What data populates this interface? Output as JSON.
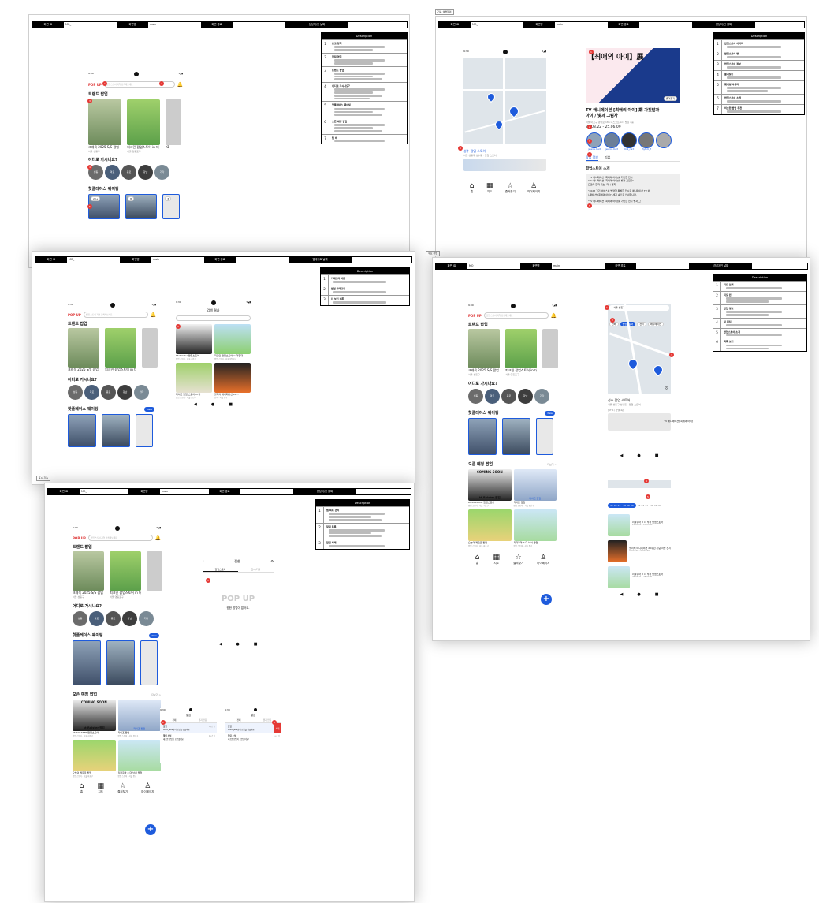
{
  "header": {
    "screen_id_label": "화면 ID",
    "screen_id_value": "MO_",
    "screen_name_label": "화면명",
    "screen_name_value": "main",
    "path_label": "화면 경로",
    "owner": "담당자/인 날짜",
    "owner_alt": "업데이트 날짜"
  },
  "description_title": "Description",
  "panel_tags": [
    "기능 설명정의",
    "주요 화면",
    "표시 기능"
  ],
  "colors": {
    "accent": "#1e5bdc",
    "pin": "#e53935",
    "header_bg": "#000000"
  },
  "app": {
    "logo": "POP UP",
    "search_placeholder": "팝업 스토어 지역 검색해보세요",
    "time": "9:30",
    "sections": {
      "trending": "트렌드 팝업",
      "where": "어디로 가시나요?",
      "waiting": "핫플레이스 웨이팅",
      "upcoming": "오픈 예정 팝업"
    },
    "new_badge": "New",
    "trending_cards": [
      {
        "title": "크레욱 2025 S/S 팝업",
        "loc": "서울 성동구"
      },
      {
        "title": "피크민 팝업스토어 in 더",
        "loc": "서울 영등포구"
      },
      {
        "title": "KE",
        "loc": "서"
      }
    ],
    "regions": [
      "성동",
      "마포",
      "종로",
      "강남",
      "기타"
    ],
    "waiting_counts": [
      "20+",
      "8",
      "3"
    ],
    "waiting_cards": [
      "크레욱 & 전시",
      "2025 S/S 팝업",
      "더현대"
    ],
    "upcoming_cards": [
      {
        "title": "KT ROLSTER 팝업스토어",
        "sub": "팝업 스토어 · 서울 서초구"
      },
      {
        "title": "라이즈 팝업",
        "sub": "팝업 스토어 · 서울 용산구"
      },
      {
        "title": "오늘의 케로로 팝업",
        "sub": "팝업 스토어 · 서울 마포구"
      },
      {
        "title": "리락쿠마 X 더 낙서 팝업",
        "sub": "팝업 스토어 · 서울 중구"
      }
    ],
    "coming_soon": "COMING SOON",
    "kt_caption": "kt Rolster 팝업",
    "rize_caption": "라이즈 팝업",
    "view_all": "더보기 >",
    "nav": [
      "홈",
      "지도",
      "즐겨찾기",
      "마이페이지"
    ],
    "nav_icons": [
      "home-icon",
      "map-icon",
      "star-icon",
      "person-icon"
    ]
  },
  "detail": {
    "title_line1": "TV 애니메이션 [최애의 아이] 期 가짓말과",
    "title_line2": "아이 / 빛과 그림자",
    "banner": "【최애의 아이】展",
    "address": "서울 마포구 양화로 186 더스코프(LC) 빌딩 2층",
    "period": "25.03.22 - 25.06.09",
    "fav_button": "즐겨찾기",
    "avatars": [
      "jessica.mart",
      "jessica.mart",
      "milk_card",
      "rhythm_7",
      ""
    ],
    "tabs": [
      "팝업 정보",
      "리뷰"
    ],
    "intro_title": "팝업스토어 소개",
    "intro_lines": [
      "\"TV 애니메이션 [최애의 아이]를 기반한 전시\"",
      "\"TV 애니메이션 [최애의 아이]를 빛과 그림자\"",
      "도쿄와 한국 최초, 국시 개최!",
      "",
      "\"2023 고기 서비스를 방영한 특별한 전시로 애니메이션 TV 애",
      "니메이션 [최애의 아이]\" 세계 속으로 안내합니다.",
      "",
      "\"TV 애니메이션 [최애의 아이]를 기반한 전시 빛과 그"
    ]
  },
  "map_screen": {
    "search": "서울 성동구",
    "filters": [
      "전체",
      "팝업스토어",
      "전시",
      "애니메이션"
    ],
    "result_title": "성수 팝업 스토어",
    "result_sub": "서울 성동구 성수동 · 팝업 스토어",
    "result_title2": "을지로 팝업스토어"
  },
  "map_list": {
    "date_tag": "25.03.22 - 25.06.09",
    "items": [
      {
        "title": "리락쿠마 X 더 낙서 팝업스토어",
        "date": "25.03.21 - 25.03.31"
      },
      {
        "title": "블리치 애니메이션 20주년 기념 서울 전시",
        "date": "25.03.28 - 25.04.20"
      },
      {
        "title": "리락쿠마 X 더 낙서 팝업스토어",
        "date": "25.03.21 - 25.03.31"
      }
    ],
    "kt_label": "[KT 1) 판넬 속]",
    "preview_title": "TV 애니메이션 [최애의 아이]"
  },
  "category": {
    "title": "검색 결과",
    "cards": [
      {
        "title": "KT Rolster 팝업스토어",
        "sub": "팝업 스토어 · 서울 서초구"
      },
      {
        "title": "피크민 팝업스토어 in 더현대",
        "sub": "팝업 스토어 · 서울 영등포구"
      },
      {
        "title": "라이즈 팝업 스토어 in 더",
        "sub": "팝업 스토어 · 서울 용산구"
      },
      {
        "title": "블리치 애니메이션 20...",
        "sub": "전시 · 서울 중구"
      }
    ]
  },
  "favorites": {
    "title": "찜한",
    "tabs": [
      "팝업스토어",
      "전시/기타"
    ],
    "empty": "찜한 팝업이 없어요."
  },
  "notifications": {
    "title": "알림",
    "tabs": [
      "전체",
      "읽지 않음"
    ],
    "items": [
      {
        "title": "팝업",
        "text": "MMO_Jace님이 팝업을 찜했어요.",
        "time": "1시간 전"
      },
      {
        "title": "알림 소식",
        "text": "새로운 팝업이 오픈했어요!",
        "time": "2시간 전"
      }
    ],
    "delete": "삭제"
  },
  "descriptions": {
    "p1": [
      {
        "n": "1",
        "title": "로고 영역",
        "lines": 2
      },
      {
        "n": "2",
        "title": "알림 영역",
        "lines": 2
      },
      {
        "n": "3",
        "title": "트렌드 팝업",
        "lines": 3
      },
      {
        "n": "4",
        "title": "어디로 가시나요?",
        "lines": 4
      },
      {
        "n": "5",
        "title": "핫플레이스 웨이팅",
        "lines": 3
      },
      {
        "n": "6",
        "title": "오픈 예정 팝업",
        "lines": 3
      },
      {
        "n": "7",
        "title": "탭 바",
        "lines": 1
      }
    ],
    "p2": [
      {
        "n": "1",
        "title": "팝업스토어 이미지",
        "lines": 1
      },
      {
        "n": "2",
        "title": "팝업스토어 명",
        "lines": 1
      },
      {
        "n": "3",
        "title": "팝업스토어 정보",
        "lines": 1
      },
      {
        "n": "4",
        "title": "즐겨찾기",
        "lines": 1
      },
      {
        "n": "5",
        "title": "웨이팅 사용자",
        "lines": 2
      },
      {
        "n": "6",
        "title": "팝업스토어 소개",
        "lines": 1
      },
      {
        "n": "7",
        "title": "비슷한 팝업 추천",
        "lines": 1
      }
    ],
    "p3": [
      {
        "n": "1",
        "title": "카테고리 버튼",
        "lines": 1
      },
      {
        "n": "2",
        "title": "팝업 카테고리",
        "lines": 1
      },
      {
        "n": "3",
        "title": "더 보기 버튼",
        "lines": 1
      }
    ],
    "p4": [
      {
        "n": "1",
        "title": "지도 검색",
        "lines": 1
      },
      {
        "n": "2",
        "title": "지도 핀",
        "lines": 2
      },
      {
        "n": "3",
        "title": "팝업 정보",
        "lines": 2
      },
      {
        "n": "4",
        "title": "내 위치",
        "lines": 1
      },
      {
        "n": "5",
        "title": "팝업스토어 소개",
        "lines": 1
      },
      {
        "n": "6",
        "title": "목록 보기",
        "lines": 2
      }
    ],
    "p5": [
      {
        "n": "1",
        "title": "찜 목록 관리",
        "lines": 3
      },
      {
        "n": "2",
        "title": "알림 목록",
        "lines": 3
      },
      {
        "n": "3",
        "title": "알림 삭제",
        "lines": 1
      }
    ]
  }
}
